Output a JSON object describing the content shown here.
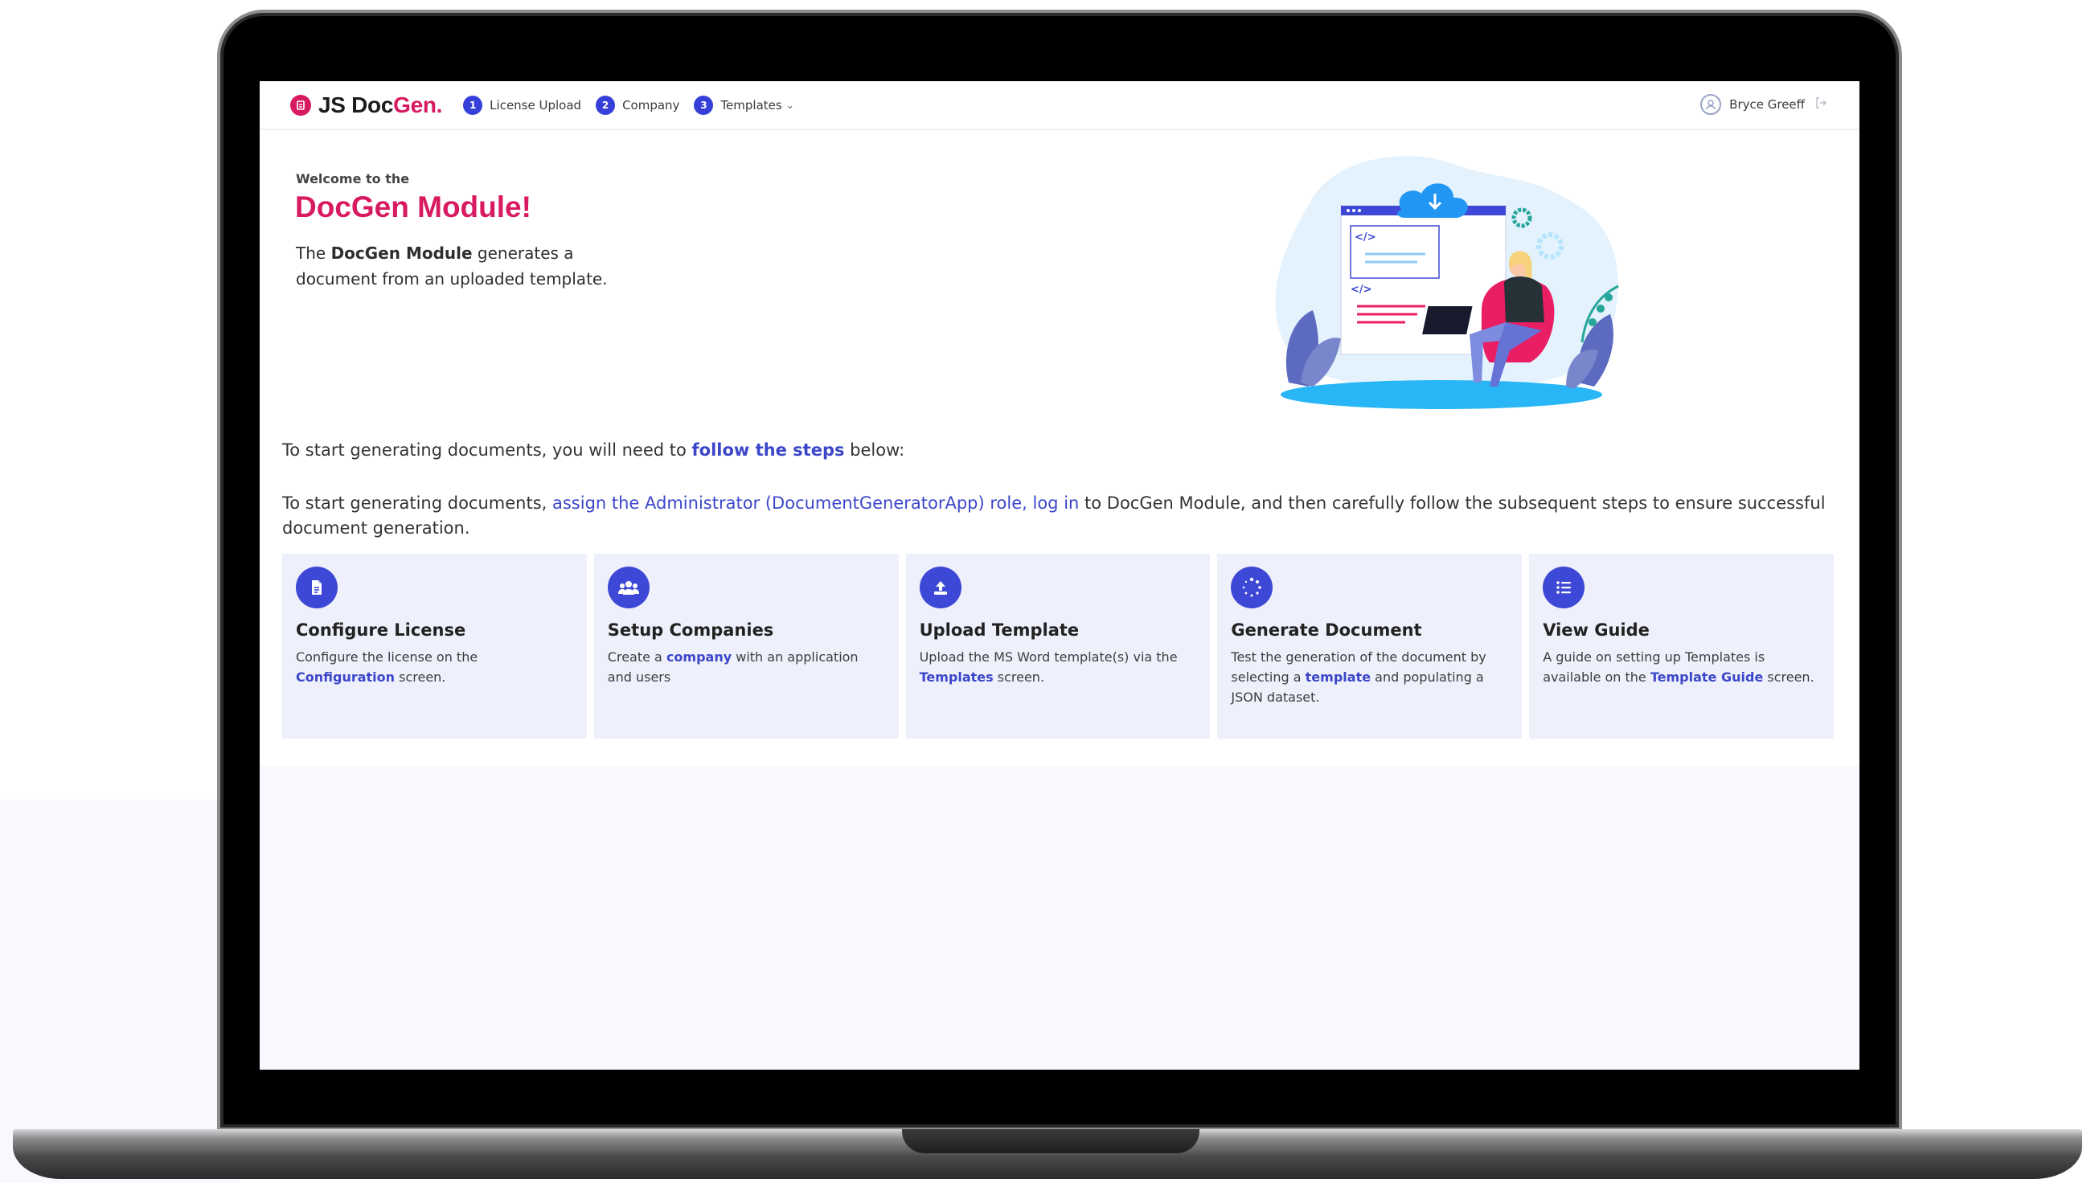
{
  "brand": {
    "name_dark": "JS Doc",
    "name_accent": "Gen."
  },
  "nav": {
    "steps": [
      {
        "number": "1",
        "label": "License Upload"
      },
      {
        "number": "2",
        "label": "Company"
      },
      {
        "number": "3",
        "label": "Templates"
      }
    ]
  },
  "user": {
    "name": "Bryce Greeff"
  },
  "hero": {
    "welcome": "Welcome to the",
    "title": "DocGen Module!",
    "desc_pre": "The ",
    "desc_bold": "DocGen Module",
    "desc_post": " generates a document from an uploaded template."
  },
  "intro": {
    "line1_pre": "To start generating documents, you will need to ",
    "line1_link": "follow the steps",
    "line1_post": " below:",
    "line2_pre": "To start generating documents, ",
    "line2_link": "assign the Administrator (DocumentGeneratorApp) role, log in",
    "line2_post": " to DocGen Module, and then carefully follow the subsequent steps to ensure successful document generation."
  },
  "cards": [
    {
      "icon": "document-icon",
      "title": "Configure License",
      "text_pre": "Configure the license on the ",
      "link": "Configuration",
      "text_post": " screen."
    },
    {
      "icon": "users-icon",
      "title": "Setup Companies",
      "text_pre": "Create a ",
      "link": "company",
      "text_post": " with an application and users"
    },
    {
      "icon": "upload-icon",
      "title": "Upload Template",
      "text_pre": "Upload the MS Word template(s) via the ",
      "link": "Templates",
      "text_post": " screen."
    },
    {
      "icon": "spinner-icon",
      "title": "Generate Document",
      "text_pre": "Test the generation of the document by selecting a ",
      "link": "template",
      "text_post": " and populating a JSON dataset."
    },
    {
      "icon": "list-icon",
      "title": "View Guide",
      "text_pre": "A guide on setting up Templates is available on the ",
      "link": "Template Guide",
      "text_post": " screen."
    }
  ],
  "colors": {
    "accent_pink": "#d81b60",
    "primary_blue": "#3d48d6",
    "card_bg": "#eef0fb"
  }
}
